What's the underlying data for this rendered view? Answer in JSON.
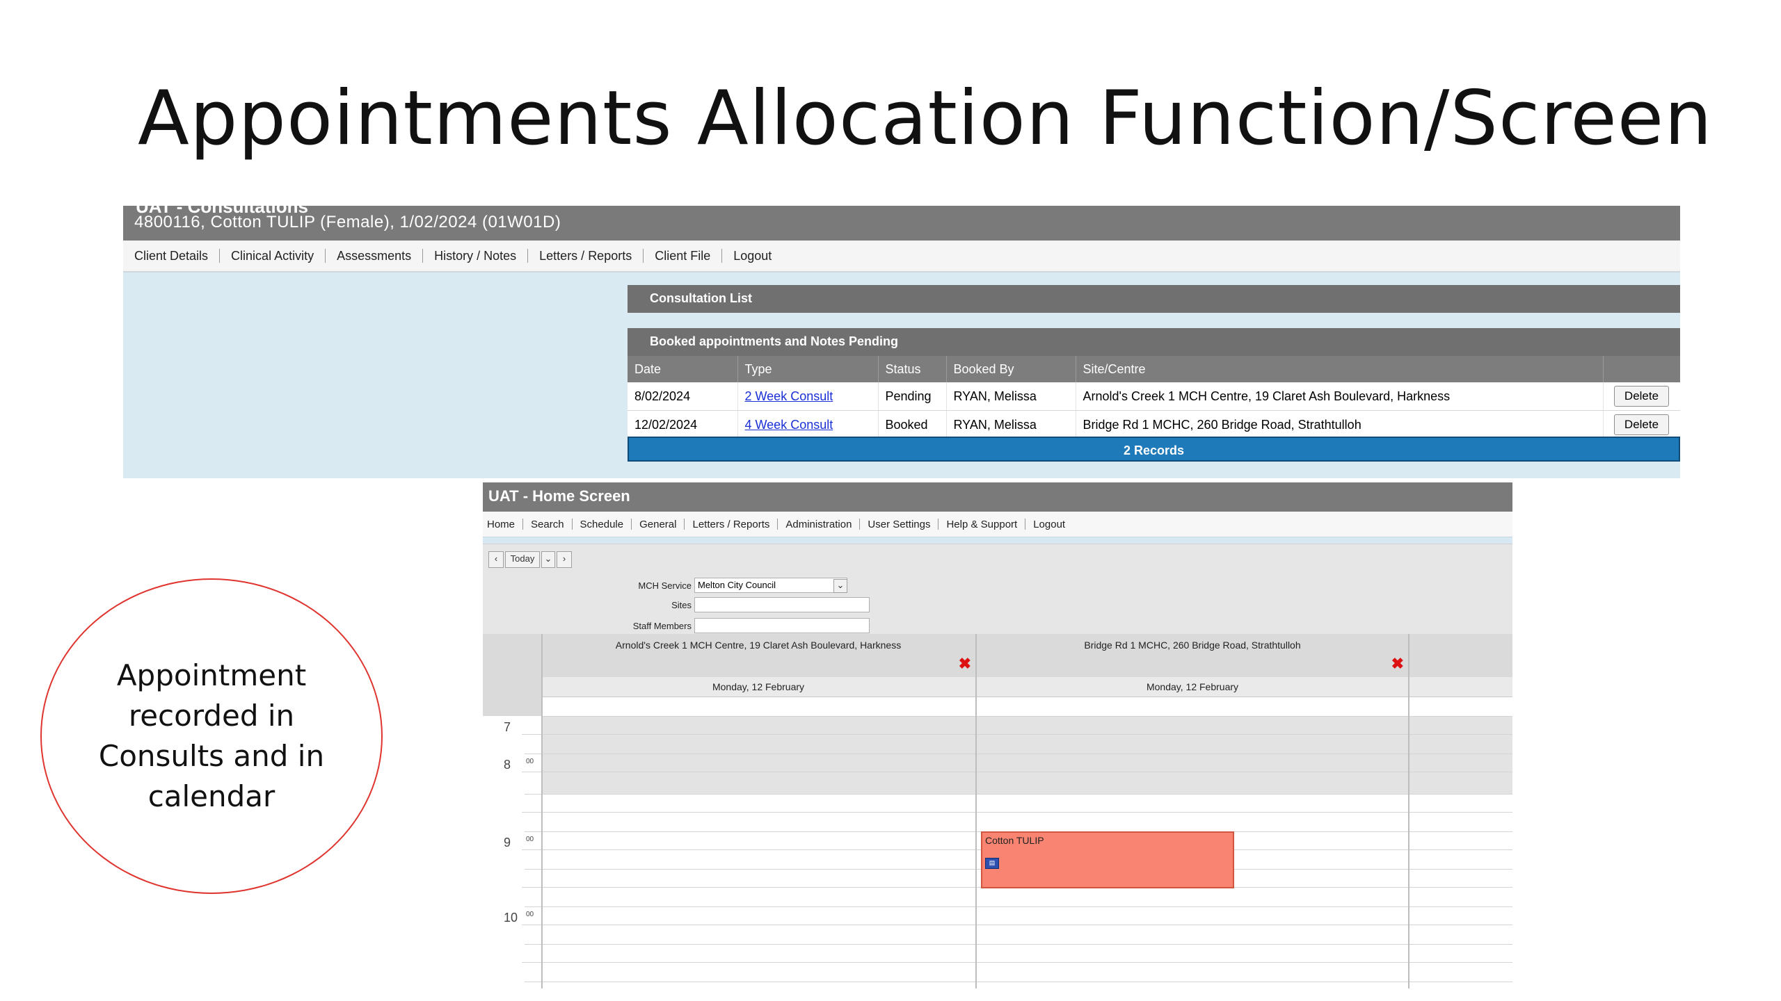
{
  "slide": {
    "title": "Appointments Allocation Function/Screen",
    "note": "Appointment recorded in Consults and in calendar"
  },
  "client_screen": {
    "cut_title": "UAT - Consultations",
    "client_title": "4800116, Cotton TULIP (Female), 1/02/2024 (01W01D)",
    "nav": [
      "Client Details",
      "Clinical Activity",
      "Assessments",
      "History / Notes",
      "Letters / Reports",
      "Client File",
      "Logout"
    ],
    "consultation_list_label": "Consultation List",
    "booked_label": "Booked appointments and Notes Pending",
    "columns": [
      "Date",
      "Type",
      "Status",
      "Booked By",
      "Site/Centre",
      ""
    ],
    "rows": [
      {
        "date": "8/02/2024",
        "type": "2 Week Consult",
        "status": "Pending",
        "booked_by": "RYAN, Melissa",
        "site": "Arnold's Creek 1 MCH Centre, 19 Claret Ash Boulevard, Harkness",
        "action": "Delete"
      },
      {
        "date": "12/02/2024",
        "type": "4 Week Consult",
        "status": "Booked",
        "booked_by": "RYAN, Melissa",
        "site": "Bridge Rd 1 MCHC, 260 Bridge Road, Strathtulloh",
        "action": "Delete"
      }
    ],
    "records_label": "2 Records"
  },
  "home_screen": {
    "title": "UAT - Home Screen",
    "nav": [
      "Home",
      "Search",
      "Schedule",
      "General",
      "Letters / Reports",
      "Administration",
      "User Settings",
      "Help & Support",
      "Logout"
    ],
    "controls": {
      "prev": "‹",
      "today": "Today",
      "dropdown": "⌄",
      "next": "›"
    },
    "filters": {
      "mch_service_label": "MCH Service",
      "mch_service_value": "Melton City Council",
      "sites_label": "Sites",
      "staff_label": "Staff Members"
    },
    "columns": [
      {
        "site": "Arnold's Creek 1 MCH Centre, 19 Claret Ash Boulevard, Harkness",
        "date": "Monday, 12 February"
      },
      {
        "site": "Bridge Rd 1 MCHC, 260 Bridge Road, Strathtulloh",
        "date": "Monday, 12 February"
      }
    ],
    "hours": [
      "7",
      "8",
      "9",
      "10"
    ],
    "minute_mark": "00",
    "event": {
      "name": "Cotton TULIP",
      "icon": "calendar-icon"
    },
    "colors": {
      "event_fill": "#f88471",
      "records_bar": "#1e7ab8",
      "close_x": "#dd1111"
    }
  }
}
